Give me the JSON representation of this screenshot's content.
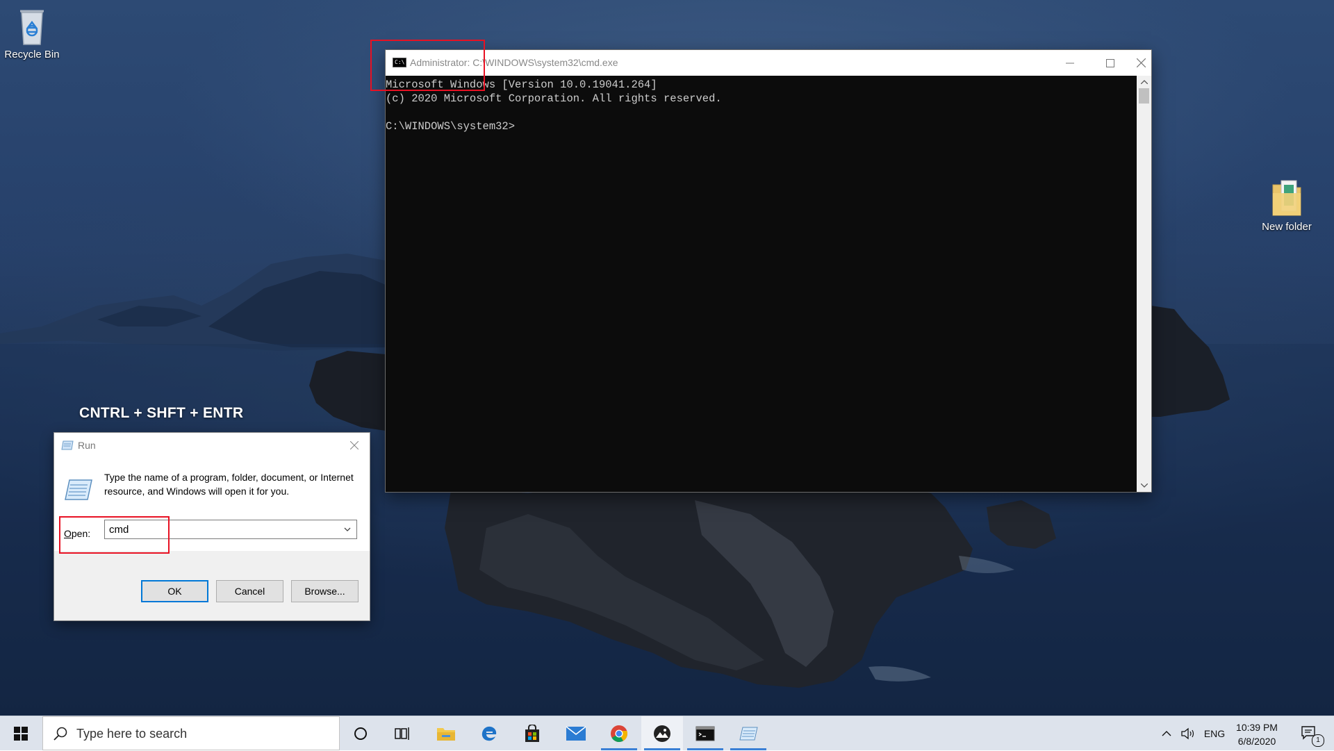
{
  "desktop": {
    "icons": [
      {
        "label": "Recycle Bin"
      },
      {
        "label": "New folder"
      }
    ],
    "hint": "CNTRL + SHFT + ENTR"
  },
  "run_dialog": {
    "title": "Run",
    "description": "Type the name of a program, folder, document, or Internet resource, and Windows will open it for you.",
    "open_label_prefix": "O",
    "open_label_rest": "pen:",
    "open_value": "cmd",
    "ok_label": "OK",
    "cancel_label": "Cancel",
    "browse_label": "Browse..."
  },
  "cmd_window": {
    "title": "Administrator: C:\\WINDOWS\\system32\\cmd.exe",
    "lines": [
      "Microsoft Windows [Version 10.0.19041.264]",
      "(c) 2020 Microsoft Corporation. All rights reserved.",
      "",
      "C:\\WINDOWS\\system32>"
    ]
  },
  "taskbar": {
    "search_placeholder": "Type here to search",
    "pinned": [
      "cortana-icon",
      "task-view-icon",
      "file-explorer-icon",
      "edge-icon",
      "store-icon",
      "mail-icon",
      "chrome-icon",
      "photos-icon",
      "cmd-icon",
      "run-icon"
    ],
    "tray": {
      "language": "ENG",
      "time": "10:39 PM",
      "date": "6/8/2020",
      "notification_count": "1"
    },
    "colors": {
      "active_bar": "#3a7fd5"
    }
  }
}
